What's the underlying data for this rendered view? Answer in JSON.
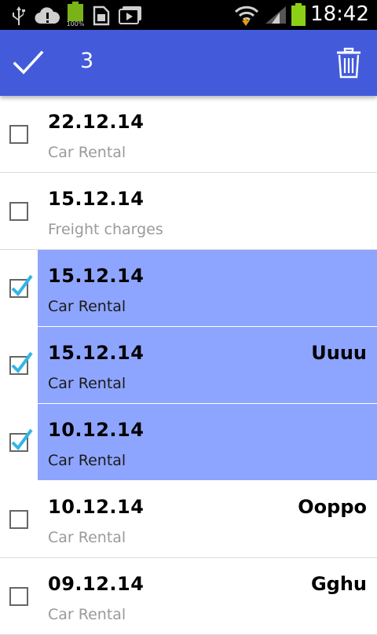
{
  "status_bar": {
    "time": "18:42",
    "battery_text": "100%",
    "icons": [
      "usb-icon",
      "cloud-alert-icon",
      "battery-small-icon",
      "sim-card-icon",
      "media-icon",
      "wifi-icon",
      "signal-icon",
      "battery-icon"
    ]
  },
  "action_bar": {
    "selected_count": "3",
    "done_icon": "check-icon",
    "delete_icon": "trash-icon",
    "color": "#435bdb"
  },
  "list": {
    "selection_color": "#8ea5ff",
    "items": [
      {
        "date": "22.12.14",
        "category": "Car Rental",
        "note": "",
        "selected": false
      },
      {
        "date": "15.12.14",
        "category": "Freight charges",
        "note": "",
        "selected": false
      },
      {
        "date": "15.12.14",
        "category": "Car Rental",
        "note": "",
        "selected": true
      },
      {
        "date": "15.12.14",
        "category": "Car Rental",
        "note": "Uuuu",
        "selected": true
      },
      {
        "date": "10.12.14",
        "category": "Car Rental",
        "note": "",
        "selected": true
      },
      {
        "date": "10.12.14",
        "category": "Car Rental",
        "note": "Ooppo",
        "selected": false
      },
      {
        "date": "09.12.14",
        "category": "Car Rental",
        "note": "Gghu",
        "selected": false
      }
    ]
  }
}
